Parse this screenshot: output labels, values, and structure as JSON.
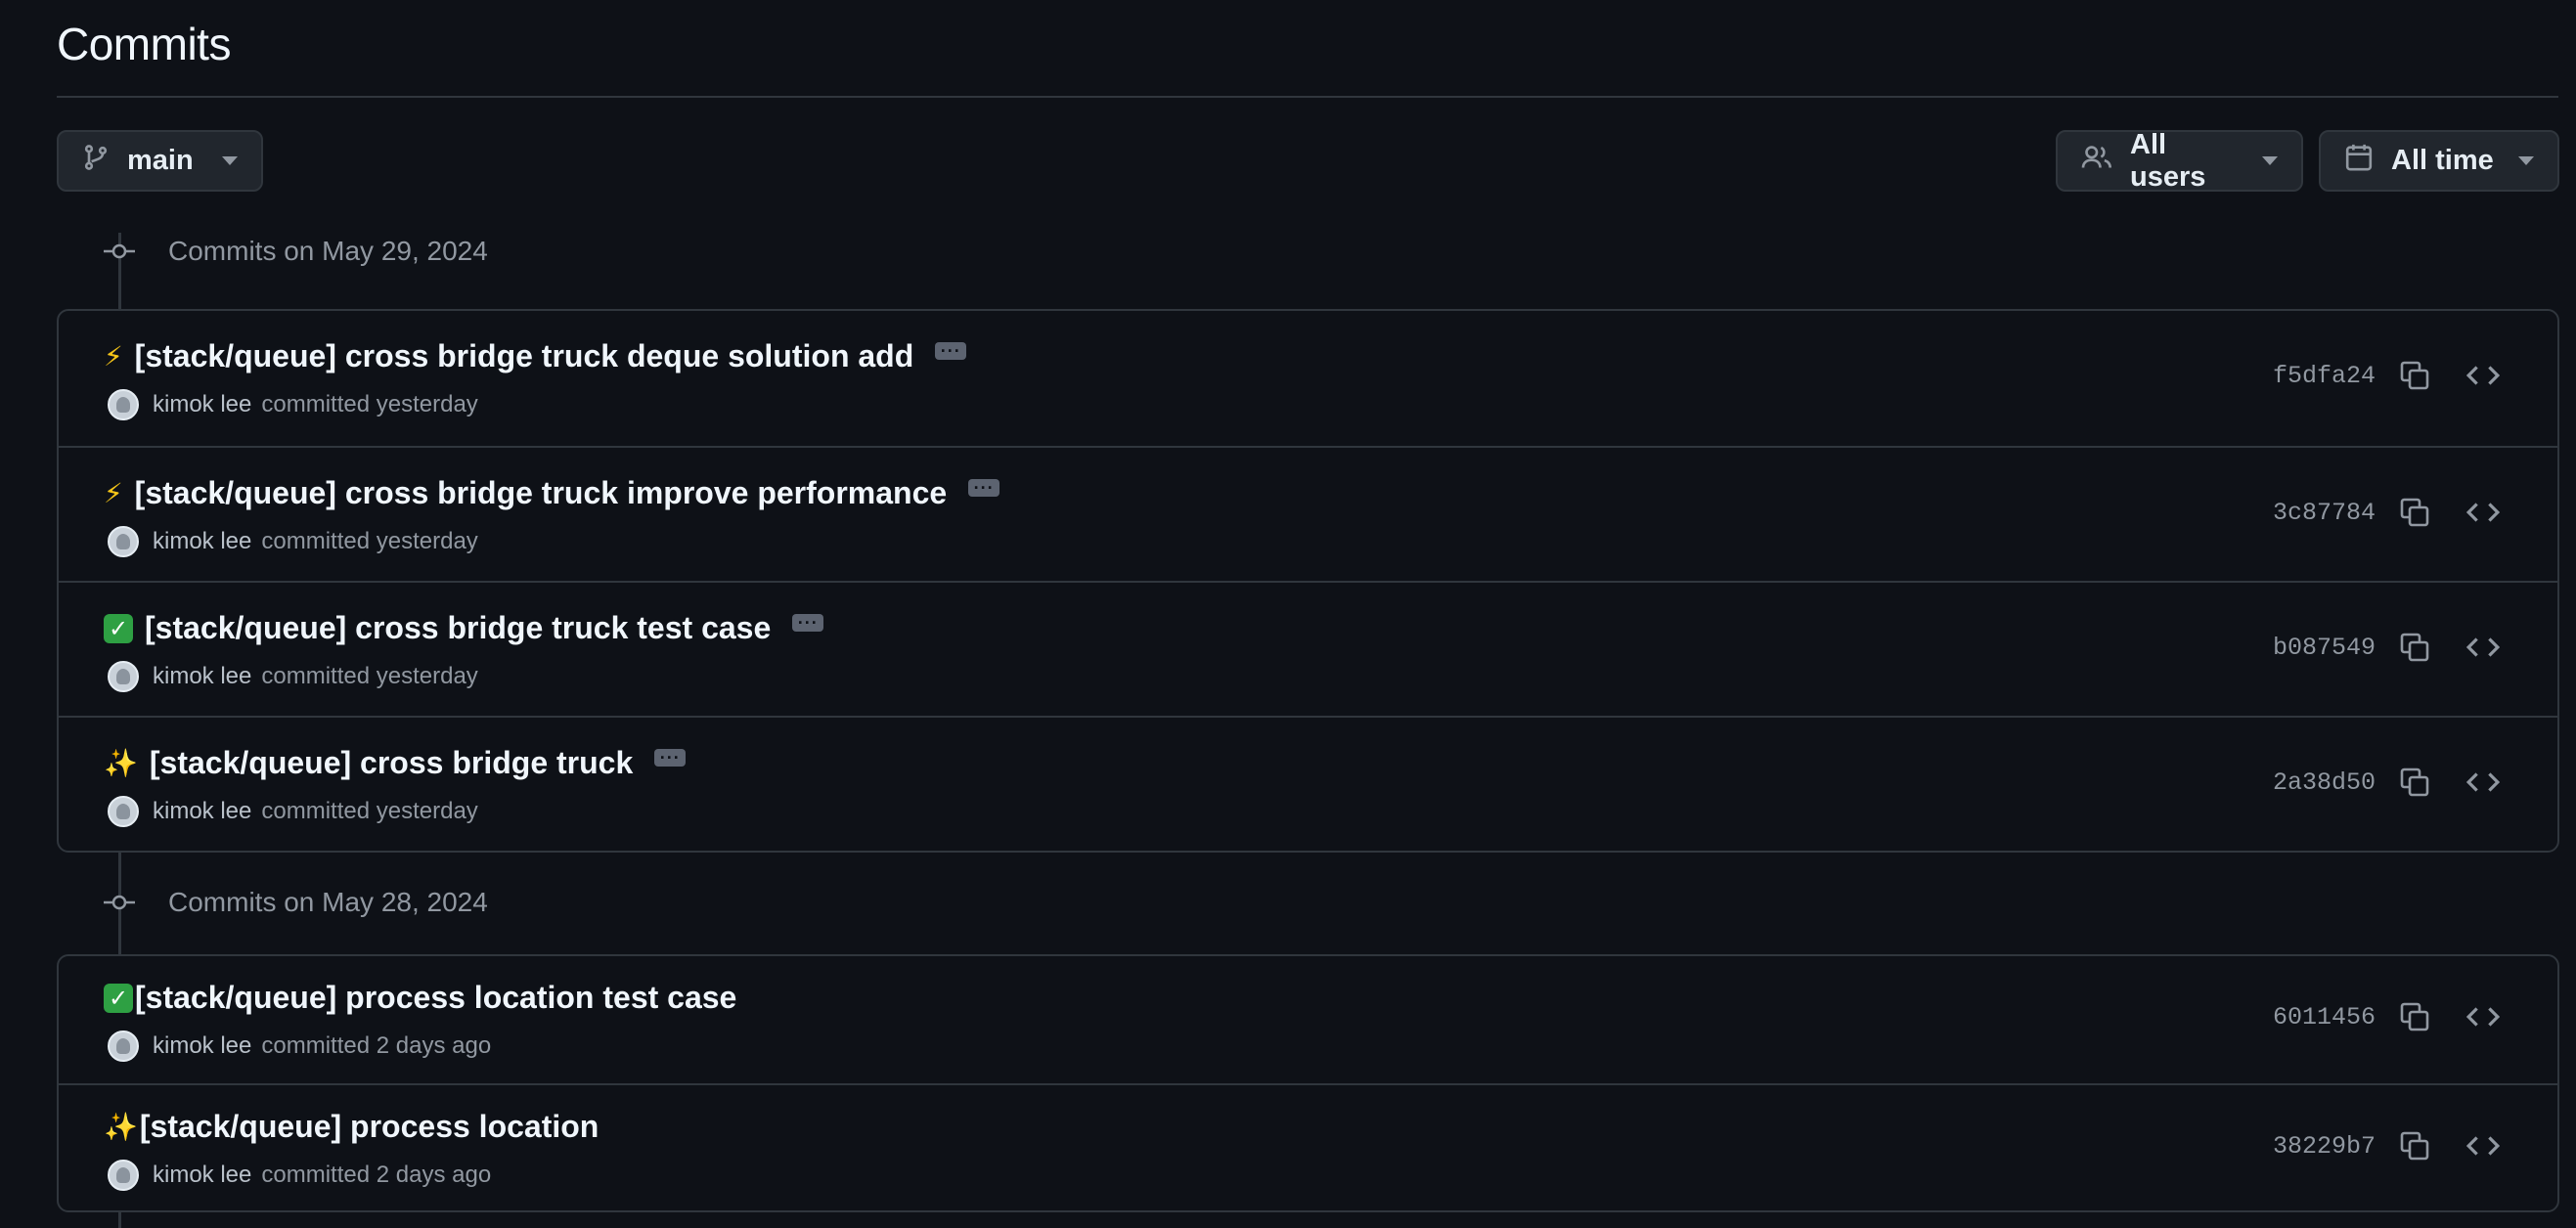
{
  "page": {
    "title": "Commits"
  },
  "filters": {
    "branch_label": "main",
    "users_label": "All users",
    "time_label": "All time"
  },
  "groups": [
    {
      "label": "Commits on May 29, 2024",
      "commits": [
        {
          "emoji": "⚡",
          "emoji_kind": "bolt",
          "message": "[stack/queue] cross bridge truck deque solution add",
          "author": "kimok lee",
          "time": "committed yesterday",
          "sha": "f5dfa24",
          "has_more": true
        },
        {
          "emoji": "⚡",
          "emoji_kind": "bolt",
          "message": "[stack/queue] cross bridge truck improve performance",
          "author": "kimok lee",
          "time": "committed yesterday",
          "sha": "3c87784",
          "has_more": true
        },
        {
          "emoji": "✓",
          "emoji_kind": "check",
          "message": "[stack/queue] cross bridge truck test case",
          "author": "kimok lee",
          "time": "committed yesterday",
          "sha": "b087549",
          "has_more": true
        },
        {
          "emoji": "✨",
          "emoji_kind": "spark",
          "message": "[stack/queue] cross bridge truck",
          "author": "kimok lee",
          "time": "committed yesterday",
          "sha": "2a38d50",
          "has_more": true
        }
      ]
    },
    {
      "label": "Commits on May 28, 2024",
      "commits": [
        {
          "emoji": "✓",
          "emoji_kind": "check",
          "message": "[stack/queue] process location test case",
          "author": "kimok lee",
          "time": "committed 2 days ago",
          "sha": "6011456",
          "has_more": false
        },
        {
          "emoji": "✨",
          "emoji_kind": "spark",
          "message": "[stack/queue] process location",
          "author": "kimok lee",
          "time": "committed 2 days ago",
          "sha": "38229b7",
          "has_more": false
        }
      ]
    }
  ]
}
